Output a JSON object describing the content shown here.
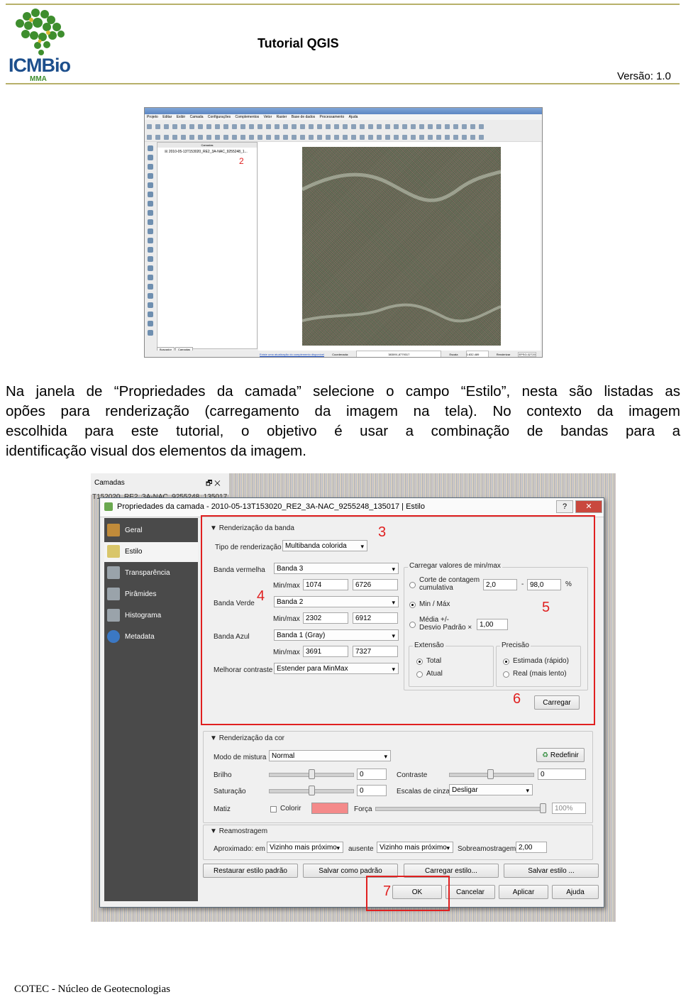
{
  "header": {
    "title": "Tutorial QGIS",
    "version": "Versão: 1.0",
    "logo_text": "ICMBio",
    "logo_sub": "MMA"
  },
  "screenshot1": {
    "menu": [
      "Projeto",
      "Editar",
      "Exibir",
      "Camada",
      "Configurações",
      "Complementos",
      "Vetor",
      "Raster",
      "Base de dados",
      "Processamento",
      "Ajuda"
    ],
    "layers_title": "Camadas",
    "layer_name": "2010-05-13T153020_RE2_3A-NAC_9255248_1...",
    "marker": "2",
    "tabs": [
      "Buscador",
      "Camadas"
    ],
    "status": {
      "message": "Existe uma atualização do complemento disponível",
      "coord_label": "Coordenada:",
      "coord_value": "383091,8779317",
      "scale_label": "Escala",
      "scale_value": "1:832.489",
      "render_label": "Renderizar",
      "crs": "EPSG:32720"
    }
  },
  "paragraph": {
    "line1": "Na janela de “Propriedades da camada” selecione o campo “Estilo”, nesta são listadas as",
    "line2": "opões para renderização (carregamento da imagem na tela). No contexto da imagem",
    "line3": "escolhida para este tutorial, o objetivo é usar a combinação de bandas para a",
    "line4": "identificação visual dos elementos da imagem."
  },
  "screenshot2": {
    "camadas_label": "Camadas",
    "layer_line": "T152020_RE2_3A-NAC_9255248_135017",
    "dialog_title": "Propriedades da camada - 2010-05-13T153020_RE2_3A-NAC_9255248_135017 | Estilo",
    "help_btn": "?",
    "close_btn": "✕",
    "sidebar": [
      "Geral",
      "Estilo",
      "Transparência",
      "Pirâmides",
      "Histograma",
      "Metadata"
    ],
    "render_band": {
      "title": "Renderização da banda",
      "type_label": "Tipo de renderização",
      "type_value": "Multibanda colorida",
      "red_label": "Banda vermelha",
      "red_value": "Banda 3",
      "minmax_label": "Min/max",
      "red_min": "1074",
      "red_max": "6726",
      "green_label": "Banda Verde",
      "green_value": "Banda 2",
      "green_min": "2302",
      "green_max": "6912",
      "blue_label": "Banda Azul",
      "blue_value": "Banda 1 (Gray)",
      "blue_min": "3691",
      "blue_max": "7327",
      "contrast_label": "Melhorar contraste",
      "contrast_value": "Estender para MinMax"
    },
    "load_minmax": {
      "title": "Carregar valores de min/max",
      "cut_label": "Corte de contagem",
      "cut_label2": "cumulativa",
      "cut_min": "2,0",
      "cut_sep": "-",
      "cut_max": "98,0",
      "cut_unit": "%",
      "minmax_opt": "Min / Máx",
      "mean_label": "Média +/-",
      "mean_label2": "Desvio Padrão ×",
      "mean_value": "1,00",
      "extent_title": "Extensão",
      "extent_total": "Total",
      "extent_current": "Atual",
      "precision_title": "Precisão",
      "precision_fast": "Estimada (rápido)",
      "precision_real": "Real (mais lento)",
      "load_btn": "Carregar"
    },
    "color_render": {
      "title": "Renderização da cor",
      "blend_label": "Modo de mistura",
      "blend_value": "Normal",
      "reset_btn": "Redefinir",
      "brightness_label": "Brilho",
      "brightness_value": "0",
      "contrast_label": "Contraste",
      "contrast_value": "0",
      "saturation_label": "Saturação",
      "saturation_value": "0",
      "grayscale_label": "Escalas de cinza",
      "grayscale_value": "Desligar",
      "hue_label": "Matiz",
      "colorize_label": "Colorir",
      "strength_label": "Força",
      "strength_value": "100%",
      "colorize_color": "#f48a8a"
    },
    "resampling": {
      "title": "Reamostragem",
      "zoom_in_label": "Aproximado: em",
      "zoom_in_value": "Vizinho mais próximo",
      "zoom_out_label": "ausente",
      "zoom_out_value": "Vizinho mais próximo",
      "oversampling_label": "Sobreamostragem",
      "oversampling_value": "2,00"
    },
    "style_buttons": [
      "Restaurar estilo padrão",
      "Salvar como padrão",
      "Carregar estilo...",
      "Salvar estilo ..."
    ],
    "dialog_buttons": [
      "OK",
      "Cancelar",
      "Aplicar",
      "Ajuda"
    ],
    "markers": [
      "3",
      "4",
      "5",
      "6",
      "7"
    ]
  },
  "footer": "COTEC - Núcleo de Geotecnologias",
  "colors": {
    "accent_line": "#b7b06a",
    "annotation_red": "#e02020",
    "logo_green": "#3e8e2e",
    "logo_text": "#1d4f8c"
  }
}
